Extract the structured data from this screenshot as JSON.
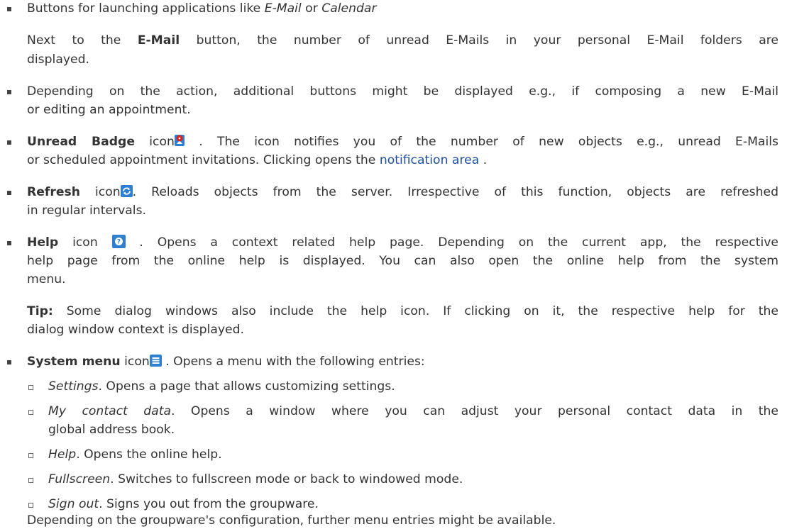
{
  "lines": {
    "l1": {
      "a": "Buttons for launching applications like ",
      "b": "E-Mail",
      "c": " or ",
      "d": "Calendar"
    },
    "l2": {
      "a": "Next to the ",
      "b": "E-Mail",
      "c": " button, the number of unread E-Mails in your personal E-Mail folders are"
    },
    "l3": "displayed.",
    "l4": "Depending on the action, additional buttons might be displayed e.g., if composing a new E-Mail",
    "l5": "or editing an appointment.",
    "l6": {
      "a": "Unread Badge",
      "b": " icon",
      "c": " . The icon notifies you of the number of new objects e.g., unread E-Mails"
    },
    "l7": {
      "a": "or scheduled appointment invitations. Clicking opens the ",
      "link": "notification area",
      "c": " ."
    },
    "l8": {
      "a": "Refresh",
      "b": " icon",
      "c": ". Reloads objects from the server. Irrespective of this function, objects are refreshed"
    },
    "l9": "in regular intervals.",
    "l10": {
      "a": "Help",
      "b": " icon ",
      "c": " . Opens a context related help page. Depending on the current app, the respective"
    },
    "l11": "help page from the online help is displayed. You can also open the online help from the system",
    "l12": "menu.",
    "l13": {
      "a": "Tip:",
      "b": " Some dialog windows also include the help icon. If clicking on it, the respective help for the"
    },
    "l14": "dialog window context is displayed.",
    "l15": {
      "a": "System menu",
      "b": " icon",
      "c": " . Opens a menu with the following entries:"
    },
    "l16": {
      "a": "Settings",
      "b": ". Opens a page that allows customizing settings."
    },
    "l17": {
      "a": "My contact data",
      "b": ". Opens a window where you can adjust your personal contact data in the"
    },
    "l18": "global address book.",
    "l19": {
      "a": "Help",
      "b": ". Opens the online help."
    },
    "l20": {
      "a": "Fullscreen",
      "b": ". Switches to fullscreen mode or back to windowed mode."
    },
    "l21": {
      "a": "Sign out",
      "b": ". Signs you out from the groupware."
    },
    "l22": "Depending on the groupware's configuration, further menu entries might be available."
  },
  "icons": {
    "unread_badge": "unread-badge-icon",
    "refresh": "refresh-icon",
    "help": "help-icon",
    "system_menu": "system-menu-icon"
  },
  "colors": {
    "text": "#333333",
    "link": "#1f4e9c",
    "icon_blue": "#2f7fd0",
    "badge_red": "#d9241c"
  }
}
